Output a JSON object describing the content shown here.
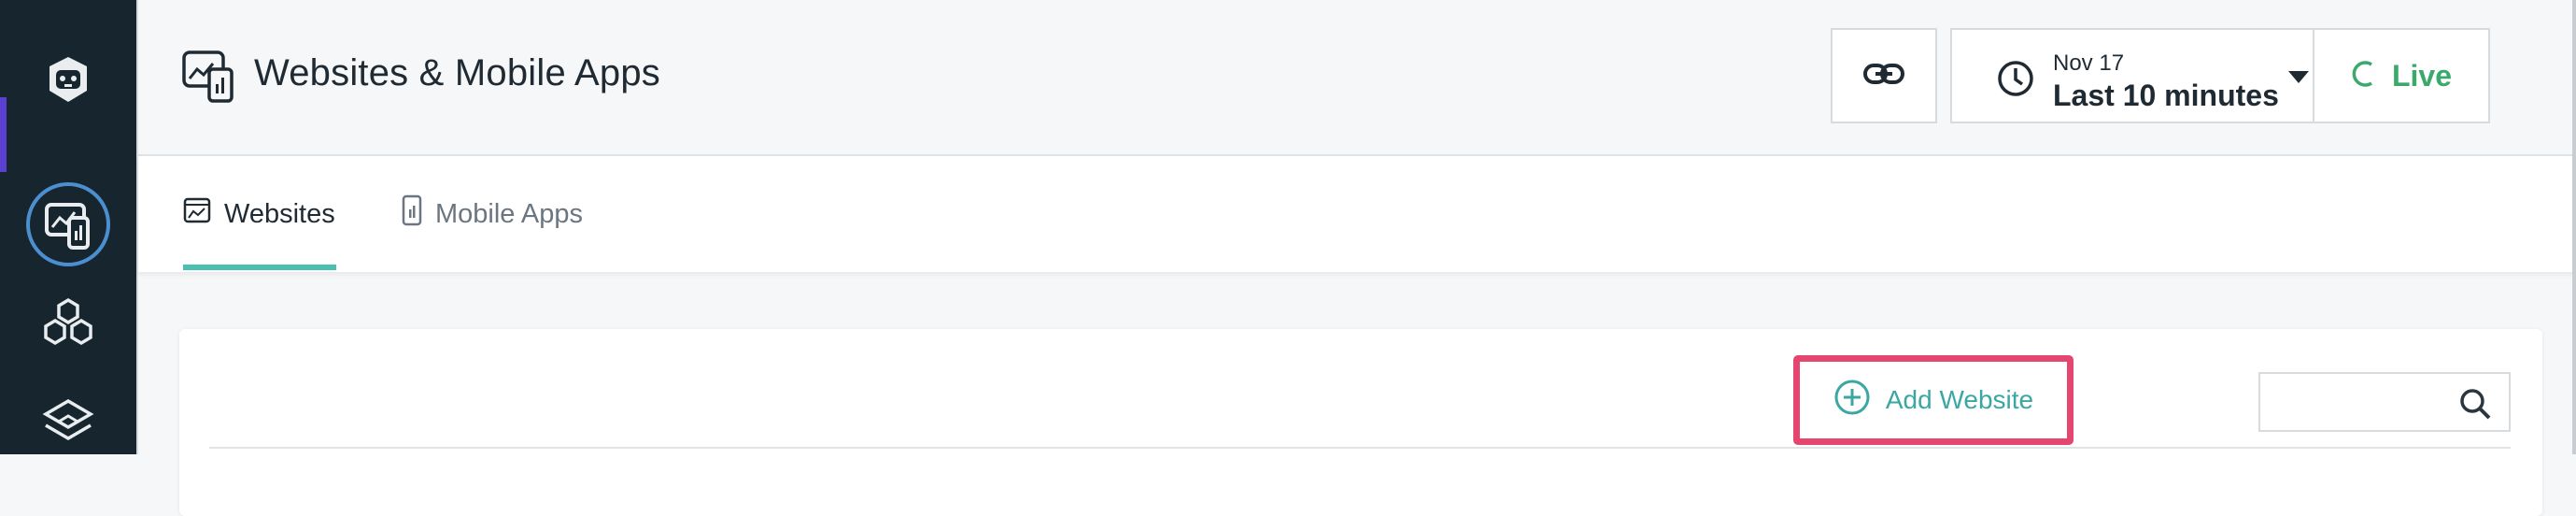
{
  "header": {
    "title": "Websites & Mobile Apps",
    "time_picker": {
      "date": "Nov 17",
      "range": "Last 10 minutes"
    },
    "live_label": "Live"
  },
  "tabs": [
    {
      "label": "Websites",
      "icon": "website-chart-icon",
      "active": true
    },
    {
      "label": "Mobile Apps",
      "icon": "mobile-app-icon",
      "active": false
    }
  ],
  "toolbar": {
    "add_label": "Add Website",
    "search_placeholder": ""
  },
  "sidebar": {
    "items": [
      {
        "icon": "robot-logo-icon"
      },
      {
        "icon": "websites-mobile-apps-icon",
        "active": true
      },
      {
        "icon": "infrastructure-icon"
      },
      {
        "icon": "platform-layers-icon"
      }
    ]
  },
  "colors": {
    "rail": "#17252e",
    "accent_teal": "#4bbfb0",
    "live_green": "#3aa96b",
    "highlight": "#e54670",
    "active_ring": "#4b8fd1"
  }
}
